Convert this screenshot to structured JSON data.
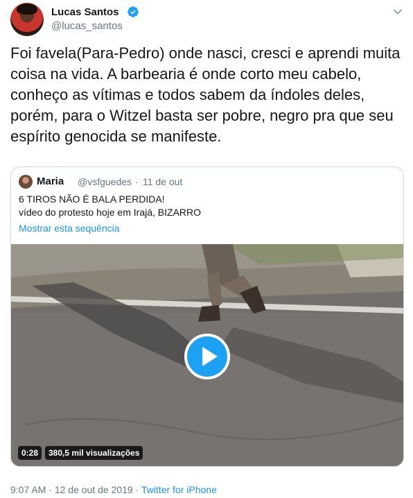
{
  "author": {
    "name": "Lucas Santos",
    "handle": "@lucas_santos",
    "verified_color": "#1da1f2"
  },
  "tweet": {
    "text": "Foi favela(Para-Pedro) onde nasci, cresci e aprendi muita coisa na vida. A barbearia é onde corto meu cabelo, conheço as vítimas e todos sabem da índoles deles, porém, para o Witzel basta ser pobre, negro pra que seu espírito genocida se manifeste."
  },
  "quoted": {
    "name": "Maria",
    "handle": "@vsfguedes",
    "separator": "·",
    "date": "11 de out",
    "line1": "6 TIROS NÃO É BALA PERDIDA!",
    "line2": "vídeo do protesto hoje em Irajá, BIZARRO",
    "thread_link": "Mostrar esta sequência",
    "video": {
      "duration": "0:28",
      "views": "380,5 mil visualizações"
    }
  },
  "footer": {
    "time": "9:07 AM",
    "separator1": "·",
    "date": "12 de out de 2019",
    "separator2": "·",
    "source": "Twitter for iPhone"
  },
  "colors": {
    "link": "#1b95e0",
    "muted": "#657786",
    "text": "#14171a",
    "accent": "#1da1f2"
  }
}
